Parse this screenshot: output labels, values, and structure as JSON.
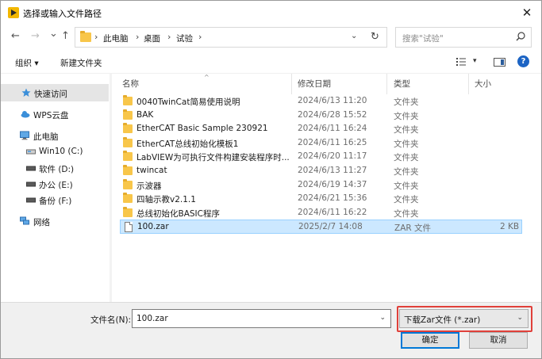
{
  "window": {
    "title": "选择或输入文件路径",
    "close_glyph": "✕"
  },
  "navbar": {
    "back_glyph": "←",
    "forward_glyph": "→",
    "recent_glyph": "⌄",
    "up_glyph": "↑",
    "breadcrumb": [
      "此电脑",
      "桌面",
      "试验"
    ],
    "crumb_sep": "›",
    "dropdown_glyph": "⌄",
    "refresh_glyph": "↻",
    "search_placeholder": "搜索\"试验\""
  },
  "toolbar": {
    "organize_label": "组织 ▾",
    "new_folder_label": "新建文件夹",
    "view_dropdown_glyph": "▾",
    "help_glyph": "?"
  },
  "nav_pane": {
    "items": [
      {
        "label": "快速访问",
        "icon": "star-icon"
      },
      {
        "label": "WPS云盘",
        "icon": "cloud-icon"
      },
      {
        "label": "此电脑",
        "icon": "computer-icon"
      },
      {
        "label": "Win10 (C:)",
        "icon": "drive-icon"
      },
      {
        "label": "软件 (D:)",
        "icon": "drive-icon"
      },
      {
        "label": "办公 (E:)",
        "icon": "drive-icon"
      },
      {
        "label": "备份 (F:)",
        "icon": "drive-icon"
      },
      {
        "label": "网络",
        "icon": "network-icon"
      }
    ]
  },
  "file_list": {
    "columns": {
      "name": "名称",
      "modified": "修改日期",
      "type": "类型",
      "size": "大小"
    },
    "sort_caret": "^",
    "rows": [
      {
        "name": "0040TwinCat简易使用说明",
        "modified": "2024/6/13 11:20",
        "type": "文件夹",
        "size": "",
        "kind": "folder"
      },
      {
        "name": "BAK",
        "modified": "2024/6/28 15:52",
        "type": "文件夹",
        "size": "",
        "kind": "folder"
      },
      {
        "name": "EtherCAT Basic Sample 230921",
        "modified": "2024/6/11 16:24",
        "type": "文件夹",
        "size": "",
        "kind": "folder"
      },
      {
        "name": "EtherCAT总线初始化模板1",
        "modified": "2024/6/11 16:25",
        "type": "文件夹",
        "size": "",
        "kind": "folder"
      },
      {
        "name": "LabVIEW为可执行文件构建安装程序时...",
        "modified": "2024/6/20 11:17",
        "type": "文件夹",
        "size": "",
        "kind": "folder"
      },
      {
        "name": "twincat",
        "modified": "2024/6/13 11:27",
        "type": "文件夹",
        "size": "",
        "kind": "folder"
      },
      {
        "name": "示波器",
        "modified": "2024/6/19 14:37",
        "type": "文件夹",
        "size": "",
        "kind": "folder"
      },
      {
        "name": "四轴示教v2.1.1",
        "modified": "2024/6/21 15:36",
        "type": "文件夹",
        "size": "",
        "kind": "folder"
      },
      {
        "name": "总线初始化BASIC程序",
        "modified": "2024/6/11 16:22",
        "type": "文件夹",
        "size": "",
        "kind": "folder"
      },
      {
        "name": "100.zar",
        "modified": "2025/2/7 14:08",
        "type": "ZAR 文件",
        "size": "2 KB",
        "kind": "file",
        "selected": true
      }
    ]
  },
  "footer": {
    "filename_label": "文件名(N):",
    "filename_value": "100.zar",
    "filename_dd_glyph": "⌄",
    "filter_value": "下载Zar文件 (*.zar)",
    "filter_dd_glyph": "⌄",
    "ok_label": "确定",
    "cancel_label": "取消"
  },
  "colors": {
    "selection_bg": "#cce8ff",
    "selection_border": "#99d1ff",
    "folder": "#f8c64a",
    "highlight_box": "#e0403a",
    "accent": "#0078d7"
  }
}
